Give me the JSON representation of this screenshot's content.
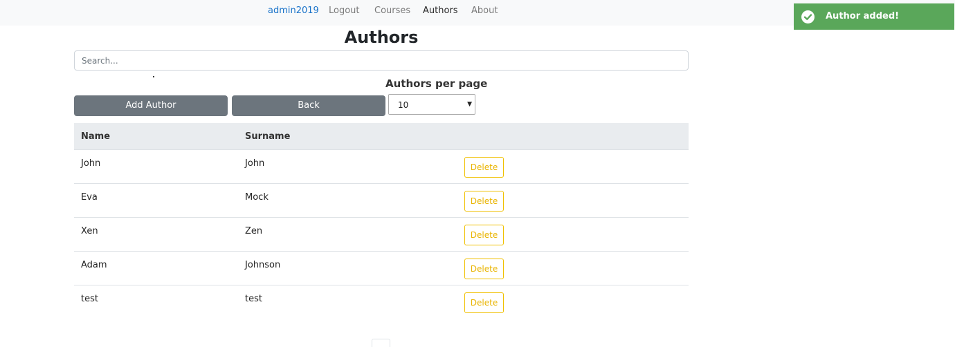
{
  "nav": {
    "items": [
      {
        "label": "admin2019"
      },
      {
        "label": "Logout"
      },
      {
        "label": "Courses"
      },
      {
        "label": "Authors"
      },
      {
        "label": "About"
      }
    ]
  },
  "toast": {
    "message": "Author added!",
    "icon": "check-circle-icon",
    "color": "#5aa75a"
  },
  "page": {
    "title": "Authors",
    "search_placeholder": "Search...",
    "per_page_label": "Authors per page",
    "per_page_value": "10",
    "add_button": "Add Author",
    "back_button": "Back"
  },
  "table": {
    "columns": [
      "Name",
      "Surname"
    ],
    "rows": [
      {
        "name": "John",
        "surname": "John",
        "action": "Delete"
      },
      {
        "name": "Eva",
        "surname": "Mock",
        "action": "Delete"
      },
      {
        "name": "Xen",
        "surname": "Zen",
        "action": "Delete"
      },
      {
        "name": "Adam",
        "surname": "Johnson",
        "action": "Delete"
      },
      {
        "name": "test",
        "surname": "test",
        "action": "Delete"
      }
    ]
  }
}
